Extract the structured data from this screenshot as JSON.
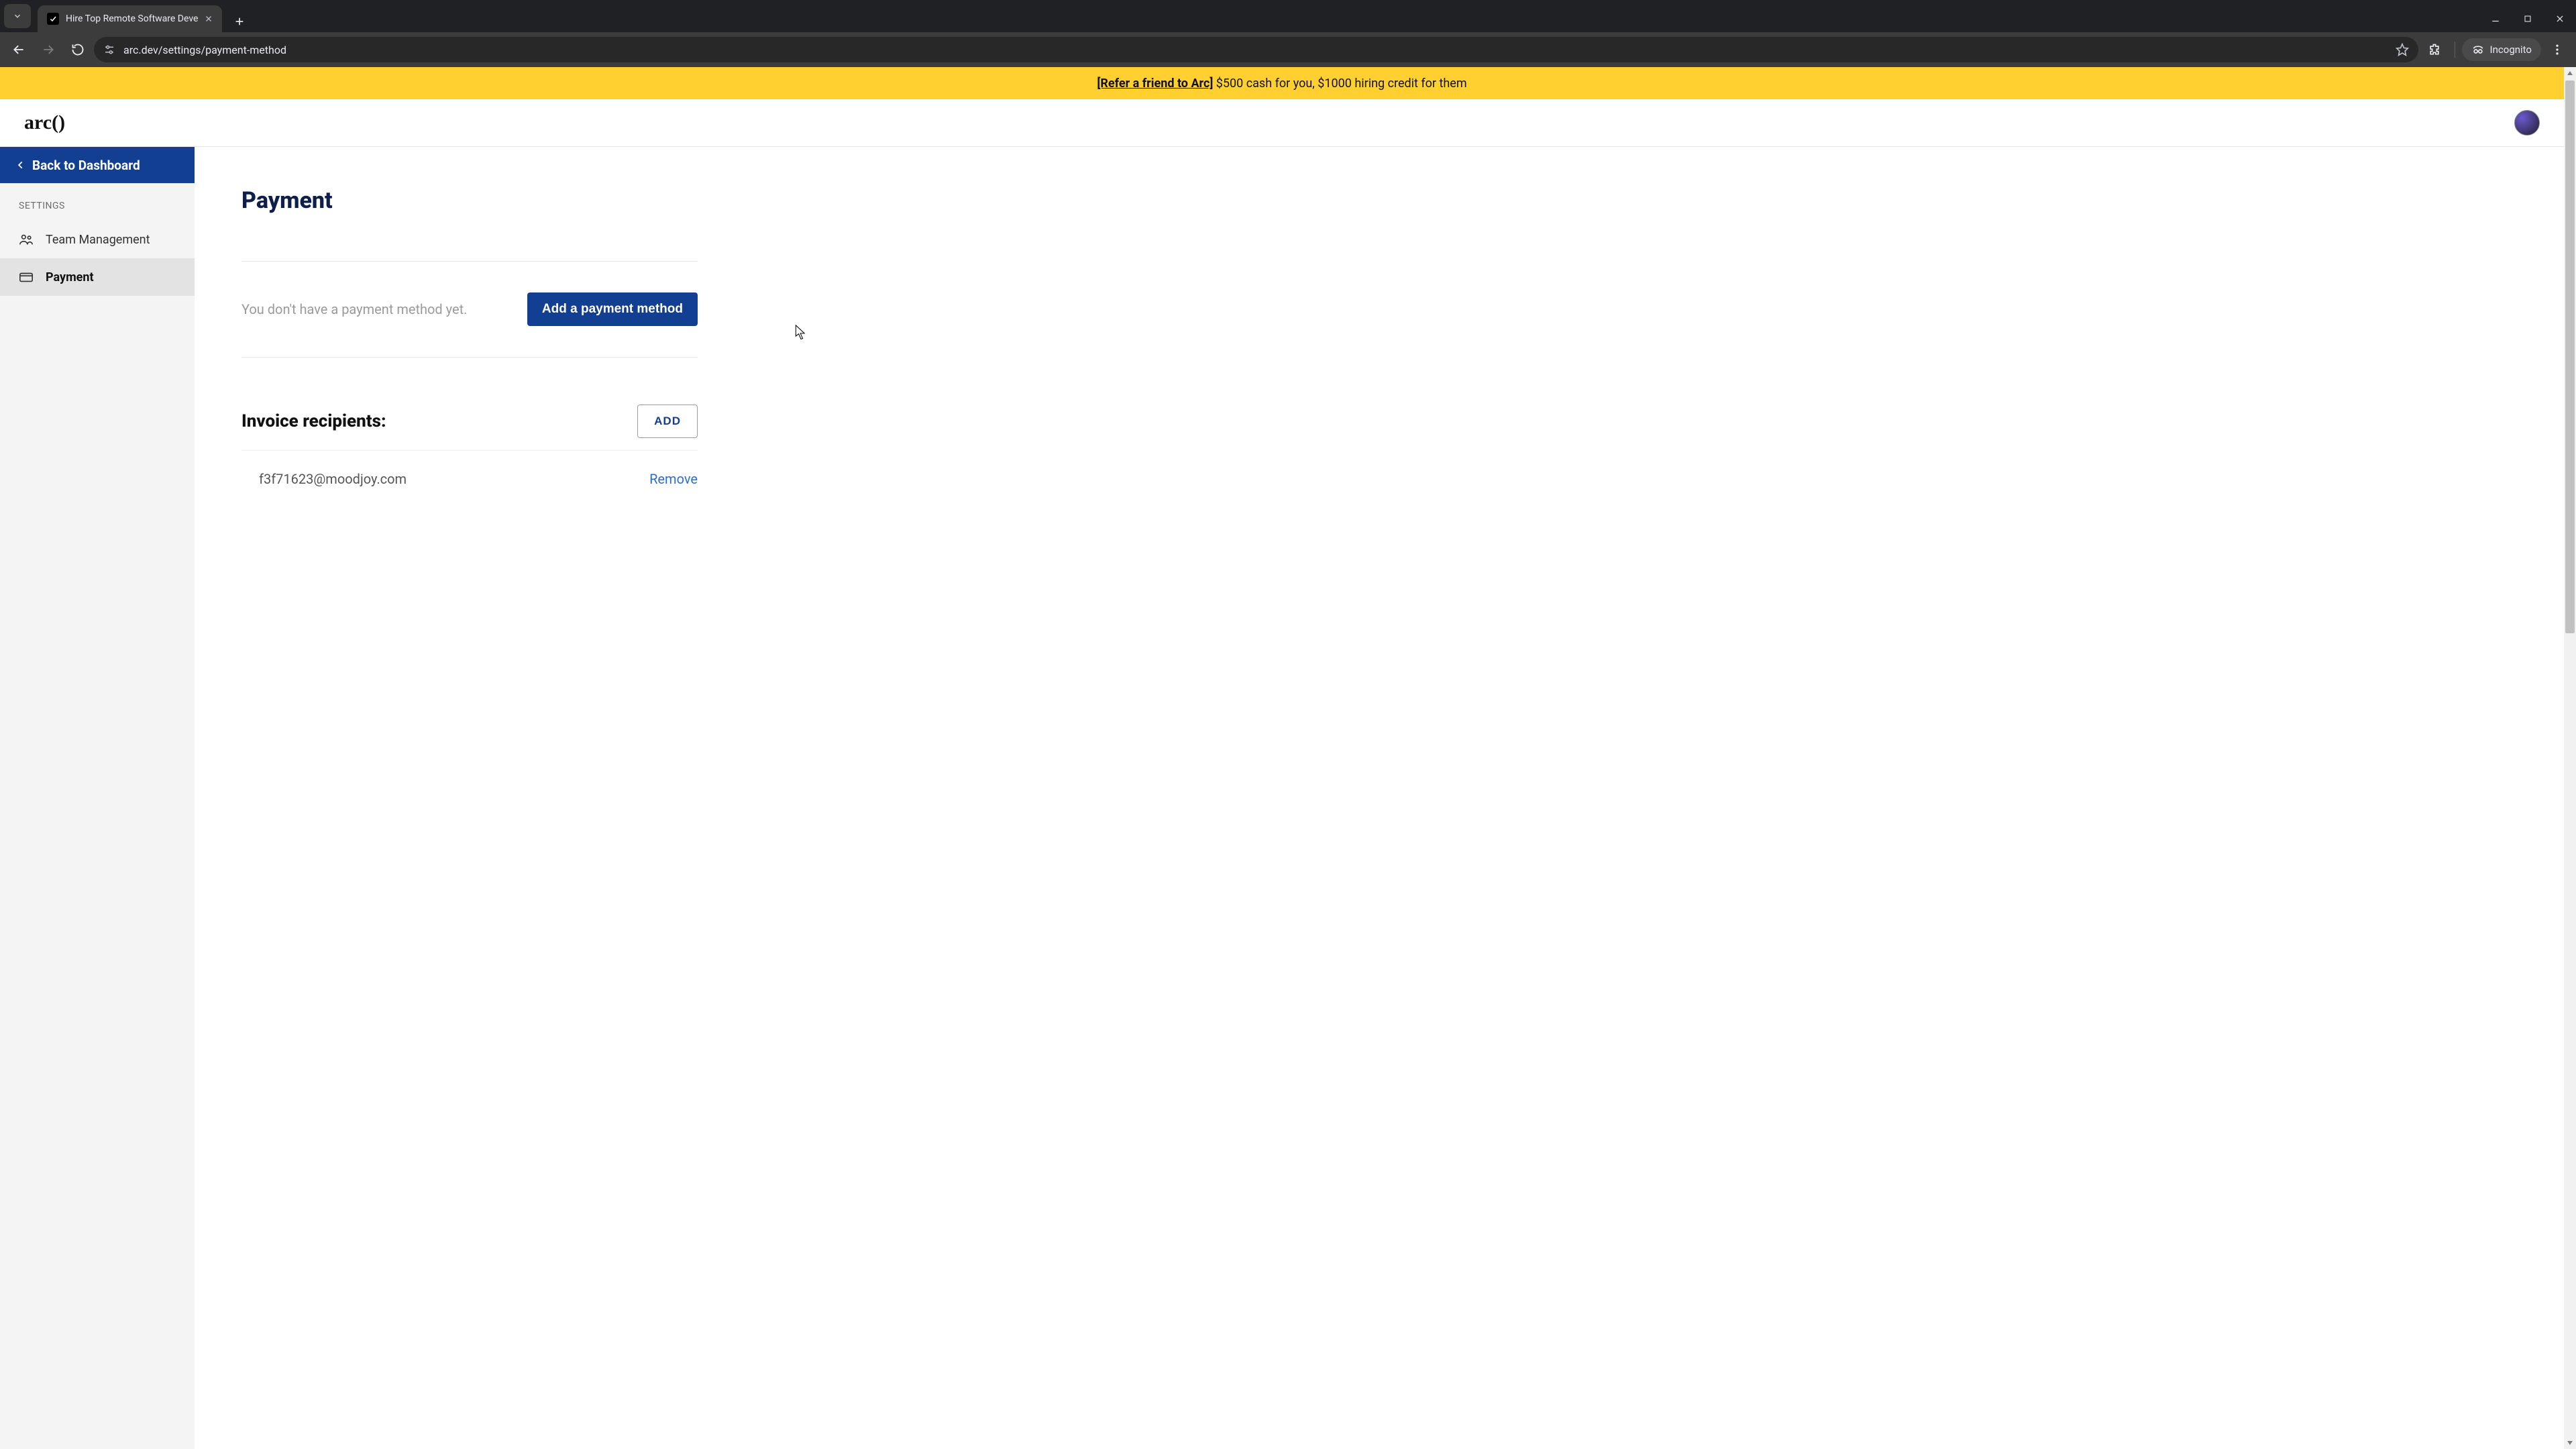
{
  "browser": {
    "tab_title": "Hire Top Remote Software Deve",
    "url": "arc.dev/settings/payment-method",
    "incognito_label": "Incognito"
  },
  "banner": {
    "link_text": "[Refer a friend to Arc]",
    "rest_text": " $500 cash for you, $1000 hiring credit for them"
  },
  "logo_text": "arc()",
  "sidebar": {
    "back_label": "Back to Dashboard",
    "heading": "SETTINGS",
    "items": [
      {
        "label": "Team Management"
      },
      {
        "label": "Payment"
      }
    ]
  },
  "main": {
    "title": "Payment",
    "no_pm_text": "You don't have a payment method yet.",
    "add_pm_button": "Add a payment method",
    "recipients_title": "Invoice recipients:",
    "recipients_add_button": "ADD",
    "recipients": [
      {
        "email": "f3f71623@moodjoy.com",
        "remove_label": "Remove"
      }
    ]
  }
}
